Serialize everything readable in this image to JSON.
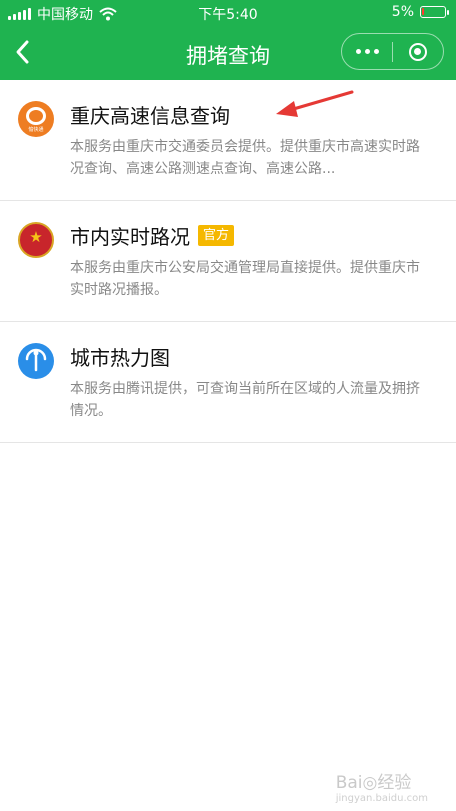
{
  "status_bar": {
    "carrier": "中国移动",
    "time": "下午5:40",
    "battery": "5%",
    "battery_level": 0.05
  },
  "navbar": {
    "title": "拥堵查询"
  },
  "services": [
    {
      "title": "重庆高速信息查询",
      "icon_label": "愉快通",
      "description": "本服务由重庆市交通委员会提供。提供重庆市高速实时路况查询、高速公路测速点查询、高速公路..."
    },
    {
      "title": "市内实时路况",
      "badge": "官方",
      "description": "本服务由重庆市公安局交通管理局直接提供。提供重庆市实时路况播报。"
    },
    {
      "title": "城市热力图",
      "description": "本服务由腾讯提供，可查询当前所在区域的人流量及拥挤情况。"
    }
  ],
  "watermark": {
    "text": "Bai◎经验",
    "sub": "jingyan.baidu.com"
  },
  "colors": {
    "nav_green": "#1fb350",
    "badge_yellow": "#f5b800",
    "arrow_red": "#e53935"
  }
}
